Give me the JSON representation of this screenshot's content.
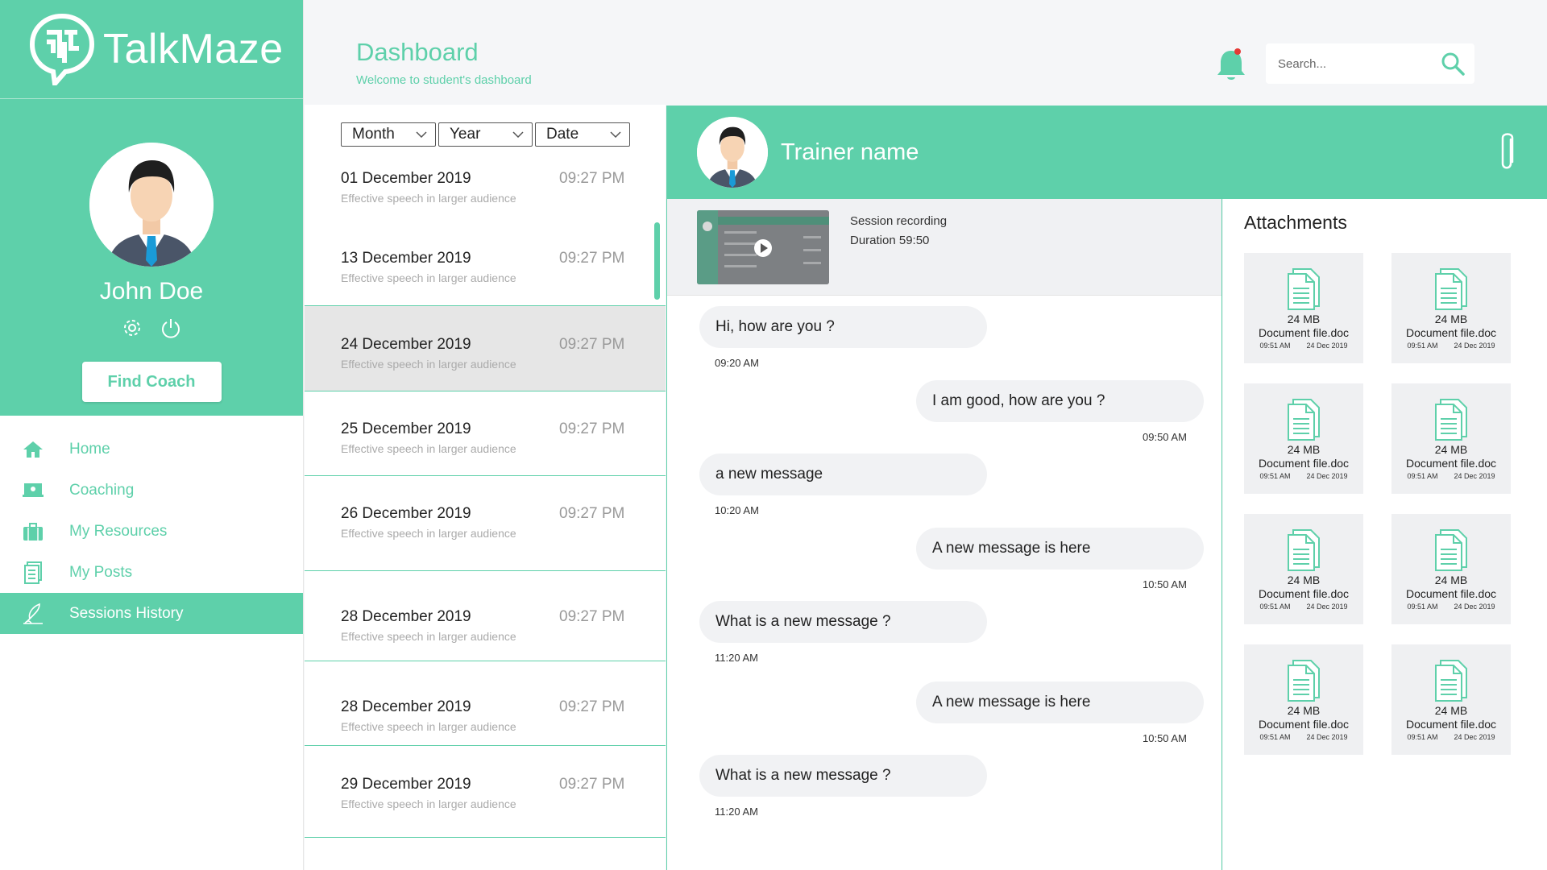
{
  "brand": {
    "name": "TalkMaze"
  },
  "colors": {
    "accent": "#5ed0aa",
    "notification_dot": "#e53935",
    "selected_row": "#e6e6e6"
  },
  "user": {
    "name": "John Doe",
    "find_coach_label": "Find Coach"
  },
  "nav": {
    "items": [
      {
        "label": "Home",
        "icon": "home-icon"
      },
      {
        "label": "Coaching",
        "icon": "presentation-icon"
      },
      {
        "label": "My Resources",
        "icon": "briefcase-icon"
      },
      {
        "label": "My Posts",
        "icon": "document-icon"
      },
      {
        "label": "Sessions History",
        "icon": "quill-icon",
        "active": true
      }
    ]
  },
  "header": {
    "title": "Dashboard",
    "subtitle": "Welcome to student's dashboard",
    "search_placeholder": "Search..."
  },
  "filters": {
    "month": "Month",
    "year": "Year",
    "date": "Date"
  },
  "sessions": [
    {
      "date": "01 December 2019",
      "time": "09:27 PM",
      "desc": "Effective speech in larger audience"
    },
    {
      "date": "13 December 2019",
      "time": "09:27 PM",
      "desc": "Effective speech in larger audience"
    },
    {
      "date": "24 December 2019",
      "time": "09:27 PM",
      "desc": "Effective speech in larger audience",
      "selected": true
    },
    {
      "date": "25 December 2019",
      "time": "09:27 PM",
      "desc": "Effective speech in larger audience"
    },
    {
      "date": "26 December 2019",
      "time": "09:27 PM",
      "desc": "Effective speech in larger audience"
    },
    {
      "date": "28 December 2019",
      "time": "09:27 PM",
      "desc": "Effective speech in larger audience"
    },
    {
      "date": "28 December 2019",
      "time": "09:27 PM",
      "desc": "Effective speech in larger audience"
    },
    {
      "date": "29 December 2019",
      "time": "09:27 PM",
      "desc": "Effective speech in larger audience"
    }
  ],
  "chat": {
    "trainer_name": "Trainer name",
    "recording": {
      "title": "Session recording",
      "duration": "Duration  59:50"
    },
    "messages": [
      {
        "text": "Hi, how are you ?",
        "time": "09:20 AM",
        "direction": "in"
      },
      {
        "text": "I am good, how are you ?",
        "time": "09:50 AM",
        "direction": "out"
      },
      {
        "text": "a new message",
        "time": "10:20 AM",
        "direction": "in"
      },
      {
        "text": "A new message is here",
        "time": "10:50 AM",
        "direction": "out"
      },
      {
        "text": "What is a new message ?",
        "time": "11:20 AM",
        "direction": "in"
      },
      {
        "text": "A new message is here",
        "time": "10:50 AM",
        "direction": "out"
      },
      {
        "text": "What is a new message ?",
        "time": "11:20 AM",
        "direction": "in"
      }
    ]
  },
  "attachments": {
    "title": "Attachments",
    "items": [
      {
        "size": "24 MB",
        "name": "Document file.doc",
        "time": "09:51 AM",
        "date": "24 Dec 2019"
      },
      {
        "size": "24 MB",
        "name": "Document file.doc",
        "time": "09:51 AM",
        "date": "24 Dec 2019"
      },
      {
        "size": "24 MB",
        "name": "Document file.doc",
        "time": "09:51 AM",
        "date": "24 Dec 2019"
      },
      {
        "size": "24 MB",
        "name": "Document file.doc",
        "time": "09:51 AM",
        "date": "24 Dec 2019"
      },
      {
        "size": "24 MB",
        "name": "Document file.doc",
        "time": "09:51 AM",
        "date": "24 Dec 2019"
      },
      {
        "size": "24 MB",
        "name": "Document file.doc",
        "time": "09:51 AM",
        "date": "24 Dec 2019"
      },
      {
        "size": "24 MB",
        "name": "Document file.doc",
        "time": "09:51 AM",
        "date": "24 Dec 2019"
      },
      {
        "size": "24 MB",
        "name": "Document file.doc",
        "time": "09:51 AM",
        "date": "24 Dec 2019"
      }
    ]
  }
}
